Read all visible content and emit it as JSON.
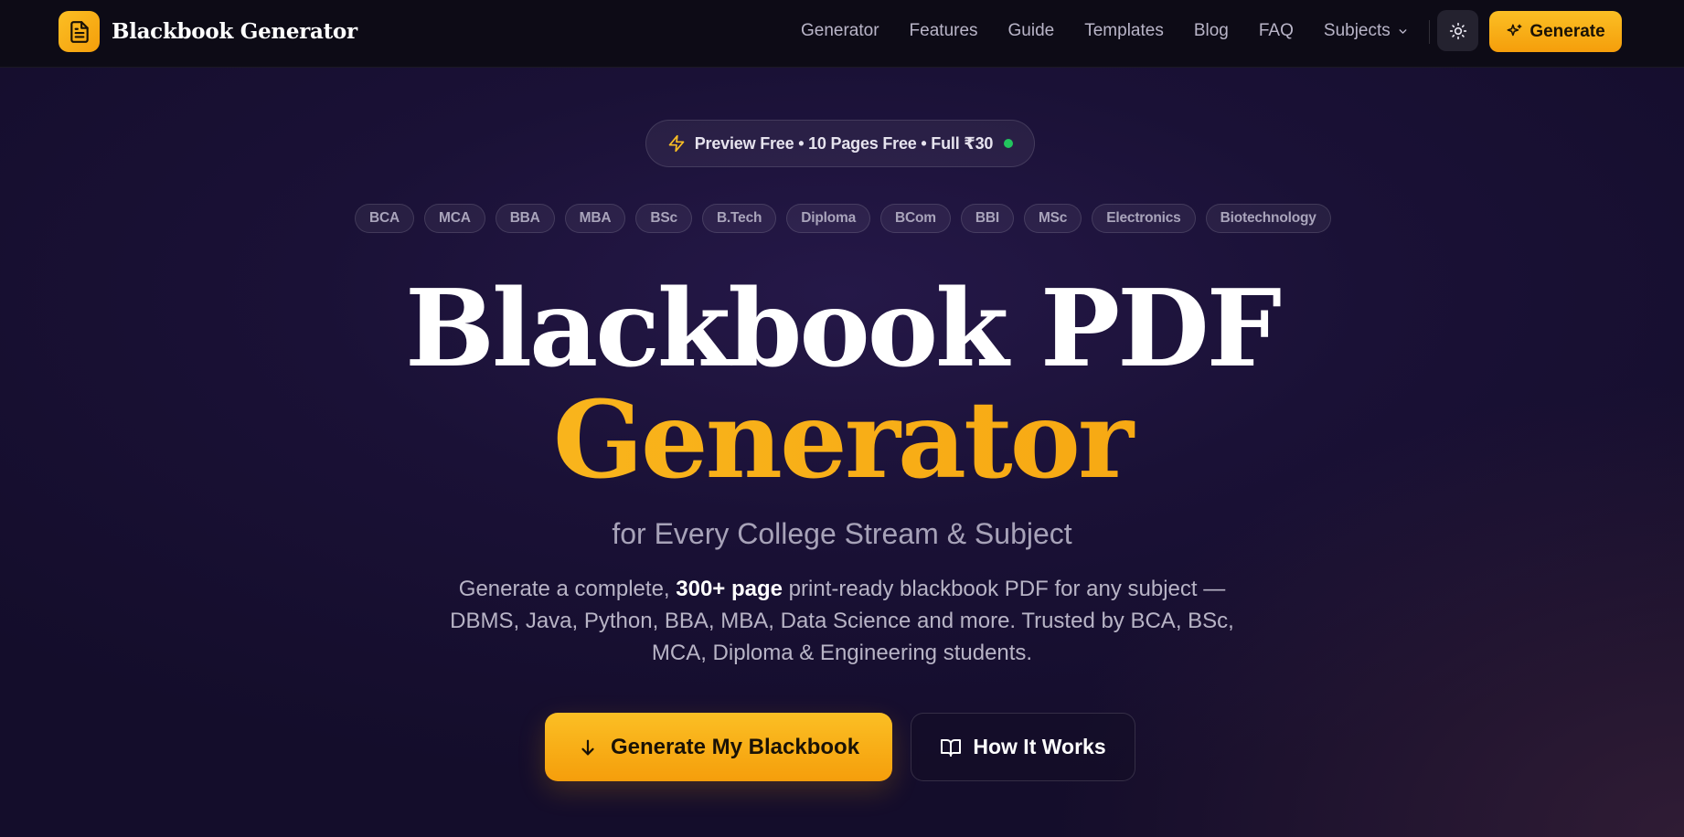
{
  "brand": {
    "name": "Blackbook Generator"
  },
  "nav": {
    "links": [
      "Generator",
      "Features",
      "Guide",
      "Templates",
      "Blog",
      "FAQ"
    ],
    "subjects_label": "Subjects",
    "generate_label": "Generate"
  },
  "promo": {
    "text": "Preview Free • 10 Pages Free • Full ₹30"
  },
  "streams": [
    "BCA",
    "MCA",
    "BBA",
    "MBA",
    "BSc",
    "B.Tech",
    "Diploma",
    "BCom",
    "BBI",
    "MSc",
    "Electronics",
    "Biotechnology"
  ],
  "hero": {
    "title_line1": "Blackbook PDF",
    "title_line2": "Generator",
    "subtitle": "for Every College Stream & Subject",
    "desc_prefix": "Generate a complete, ",
    "desc_bold": "300+ page",
    "desc_suffix": " print-ready blackbook PDF for any subject — DBMS, Java, Python, BBA, MBA, Data Science and more. Trusted by BCA, BSc, MCA, Diploma & Engineering students."
  },
  "cta": {
    "primary_label": "Generate My Blackbook",
    "secondary_label": "How It Works"
  },
  "colors": {
    "accent": "#fbbf24",
    "accent_dark": "#f59e0b",
    "nav_bg": "#0d0b16",
    "page_bg": "#1a1136",
    "status_dot": "#22c55e"
  }
}
